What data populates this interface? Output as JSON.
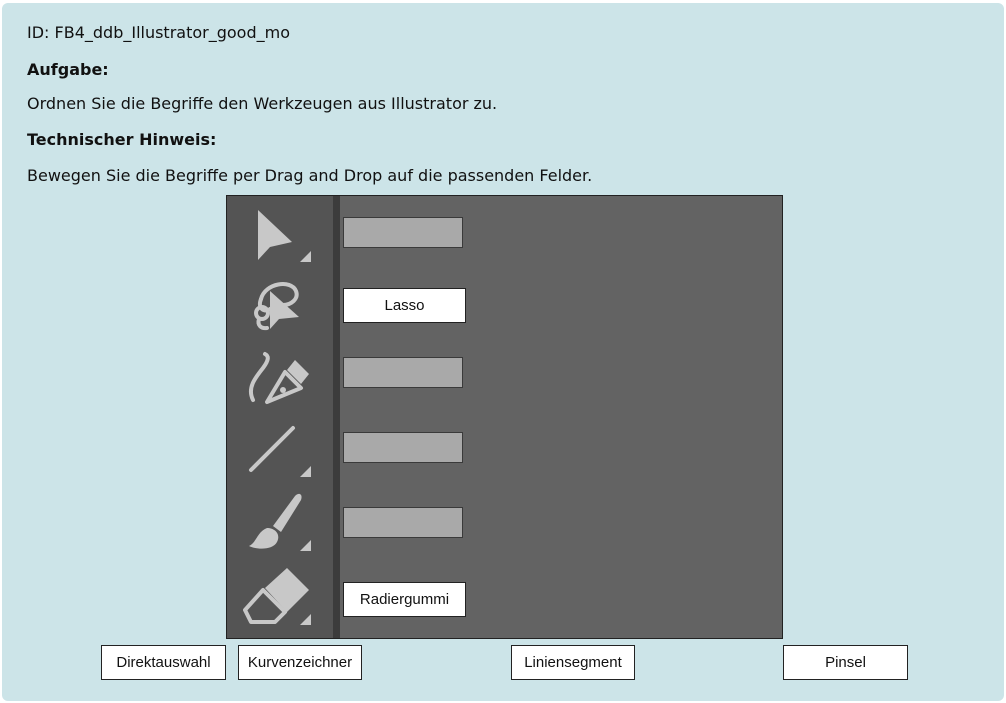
{
  "header": {
    "id_line": "ID: FB4_ddb_Illustrator_good_mo",
    "task_heading": "Aufgabe:",
    "task_text": "Ordnen Sie die Begriffe den Werkzeugen aus Illustrator zu.",
    "hint_heading": "Technischer Hinweis:",
    "hint_text": "Bewegen Sie die Begriffe per Drag and Drop auf die passenden Felder."
  },
  "toolbar": {
    "tools": [
      {
        "icon": "selection-arrow-icon",
        "slot": ""
      },
      {
        "icon": "lasso-icon",
        "slot": "Lasso"
      },
      {
        "icon": "curvature-pen-icon",
        "slot": ""
      },
      {
        "icon": "line-segment-icon",
        "slot": ""
      },
      {
        "icon": "paintbrush-icon",
        "slot": ""
      },
      {
        "icon": "eraser-icon",
        "slot": "Radiergummi"
      }
    ]
  },
  "terms": [
    "Direktauswahl",
    "Kurvenzeichner",
    "Liniensegment",
    "Pinsel"
  ],
  "colors": {
    "panel_background": "#cce4e8",
    "canvas": "#636363",
    "toolbar": "#545454",
    "icon": "#c8c8c8",
    "empty_slot": "#a9a9a9"
  }
}
